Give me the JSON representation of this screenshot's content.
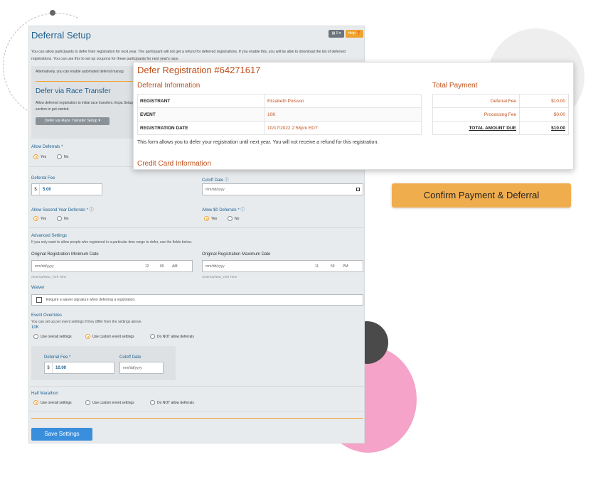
{
  "panel": {
    "title": "Deferral Setup",
    "header_btn_1": "▤ 0 ▾",
    "header_btn_2": "Help ❓",
    "intro": "You can allow participants to defer their registration for next year. The participant will not get a refund for deferred registrations. If you enable this, you will be able to download the list of deferred registrations. You can use this to set up coupons for these participants for next year's race.",
    "alt_text": "Alternatively, you can enable automated deferral manag",
    "transfer": {
      "title": "Defer via Race Transfer",
      "text": "Allow deferred registration to initial race transfers. Expa Setup\" section to get started.",
      "button": "Defer via Race Transfer Setup ▾"
    },
    "allow_deferrals": {
      "label": "Allow Deferrals *",
      "yes": "Yes",
      "no": "No"
    },
    "deferral_fee": {
      "label": "Deferral Fee",
      "prefix": "$",
      "value": "5.00"
    },
    "cutoff_date": {
      "label": "Cutoff Date ⓘ",
      "placeholder": "mm/dd/yyyy"
    },
    "second_year": {
      "label": "Allow Second Year Deferrals * ⓘ",
      "yes": "Yes",
      "no": "No"
    },
    "zero_deferrals": {
      "label": "Allow $0 Deferrals * ⓘ",
      "yes": "Yes",
      "no": "No"
    },
    "advanced": {
      "title": "Advanced Settings",
      "desc": "If you only want to allow people who registered in a particular time range to defer, use the fields below.",
      "min_label": "Original Registration Minimum Date",
      "max_label": "Original Registration Maximum Date",
      "date_ph": "mm/dd/yyyy",
      "min_time": {
        "h": "12",
        "m": "00",
        "ampm": "AM"
      },
      "max_time": {
        "h": "11",
        "m": "59",
        "ampm": "PM"
      },
      "tz": "America/New_York Time"
    },
    "waiver": {
      "title": "Waiver",
      "text": "Require a waiver signature when deferring a registration."
    },
    "overrides": {
      "title": "Event Overrides",
      "desc": "You can set up per event settings if they differ from the settings above.",
      "event1": "10K",
      "opt_overall": "Use overall settings",
      "opt_custom": "Use custom event settings",
      "opt_not": "Do NOT allow deferrals",
      "fee_label": "Deferral Fee *",
      "fee_prefix": "$",
      "fee_value": "10.00",
      "cutoff_label": "Cutoff Date",
      "cutoff_ph": "mm/dd/yyyy",
      "event2": "Half Marathon"
    },
    "save": "Save Settings"
  },
  "card": {
    "title": "Defer Registration #64271617",
    "deferral_info": "Deferral Information",
    "rows": [
      {
        "k": "REGISTRANT",
        "v": "Elizabeth Poisson"
      },
      {
        "k": "EVENT",
        "v": "10K"
      },
      {
        "k": "REGISTRATION DATE",
        "v": "10/17/2022 2:58pm EDT"
      }
    ],
    "total_payment": "Total Payment",
    "pay_rows": [
      {
        "k": "Deferral Fee",
        "v": "$10.00"
      },
      {
        "k": "Processing Fee",
        "v": "$0.00"
      },
      {
        "k": "TOTAL AMOUNT DUE",
        "v": "$10.00"
      }
    ],
    "notice": "This form allows you to defer your registration until next year. You will not receive a refund for this registration.",
    "cc_info": "Credit Card Information"
  },
  "confirm_button": "Confirm Payment & Deferral"
}
